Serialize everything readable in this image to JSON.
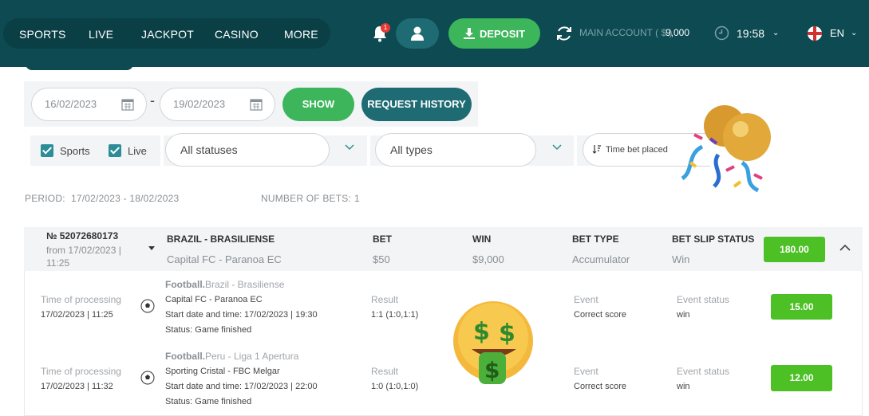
{
  "nav": {
    "items": [
      "SPORTS",
      "LIVE",
      "JACKPOT",
      "CASINO",
      "MORE"
    ],
    "notification_count": "1",
    "deposit_label": "DEPOSIT",
    "account_label": "MAIN ACCOUNT ( $ )",
    "account_value": "9,000",
    "time": "19:58",
    "language": "EN"
  },
  "filters": {
    "date_from": "16/02/2023",
    "date_to": "19/02/2023",
    "show_label": "SHOW",
    "request_history_label": "REQUEST HISTORY",
    "checkbox_sports": "Sports",
    "checkbox_live": "Live",
    "status_select": "All statuses",
    "type_select": "All types",
    "sort_select": "Time bet placed"
  },
  "summary": {
    "period_label": "PERIOD:",
    "period_value": "17/02/2023 - 18/02/2023",
    "bets_label": "NUMBER OF BETS:",
    "bets_value": "1"
  },
  "bet": {
    "id": "№ 52072680173",
    "from": "from 17/02/2023 | 11:25",
    "league": "BRAZIL - BRASILIENSE",
    "match": "Capital FC - Paranoa EC",
    "bet_title": "BET",
    "bet_value": "$50",
    "win_title": "WIN",
    "win_value": "$9,000",
    "type_title": "BET TYPE",
    "type_value": "Accumulator",
    "status_title": "BET SLIP STATUS",
    "status_value": "Win",
    "total": "180.00",
    "events": [
      {
        "processing_label": "Time of processing",
        "processing_time": "17/02/2023 | 11:25",
        "sport": "Football.",
        "league": "Brazil - Brasiliense",
        "match": "Capital FC - Paranoa EC",
        "start": "Start date and time: 17/02/2023 | 19:30",
        "status": "Status: Game finished",
        "result_label": "Result",
        "result_value": "1:1 (1:0,1:1)",
        "event_label": "Event",
        "event_value": "Correct score",
        "event_status_label": "Event status",
        "event_status_value": "win",
        "odds": "15.00"
      },
      {
        "processing_label": "Time of processing",
        "processing_time": "17/02/2023 | 11:32",
        "sport": "Football.",
        "league": "Peru - Liga 1 Apertura",
        "match": "Sporting Cristal - FBC Melgar",
        "start": "Start date and time: 17/02/2023 | 22:00",
        "status": "Status: Game finished",
        "result_label": "Result",
        "result_value": "1:0 (1:0,1:0)",
        "event_label": "Event",
        "event_value": "Correct score",
        "event_status_label": "Event status",
        "event_status_value": "win",
        "odds": "12.00"
      }
    ]
  },
  "colors": {
    "header": "#0e4a52",
    "green": "#3cb55b",
    "teal": "#1e6b73",
    "win_green": "#4cc024"
  },
  "icons": [
    "bell-icon",
    "user-icon",
    "download-icon",
    "refresh-icon",
    "clock-icon",
    "uk-flag-icon",
    "calendar-icon",
    "chevron-down-icon",
    "sort-icon",
    "chevron-up-icon",
    "soccer-ball-icon",
    "money-mouth-emoji",
    "party-balloons-decoration"
  ]
}
